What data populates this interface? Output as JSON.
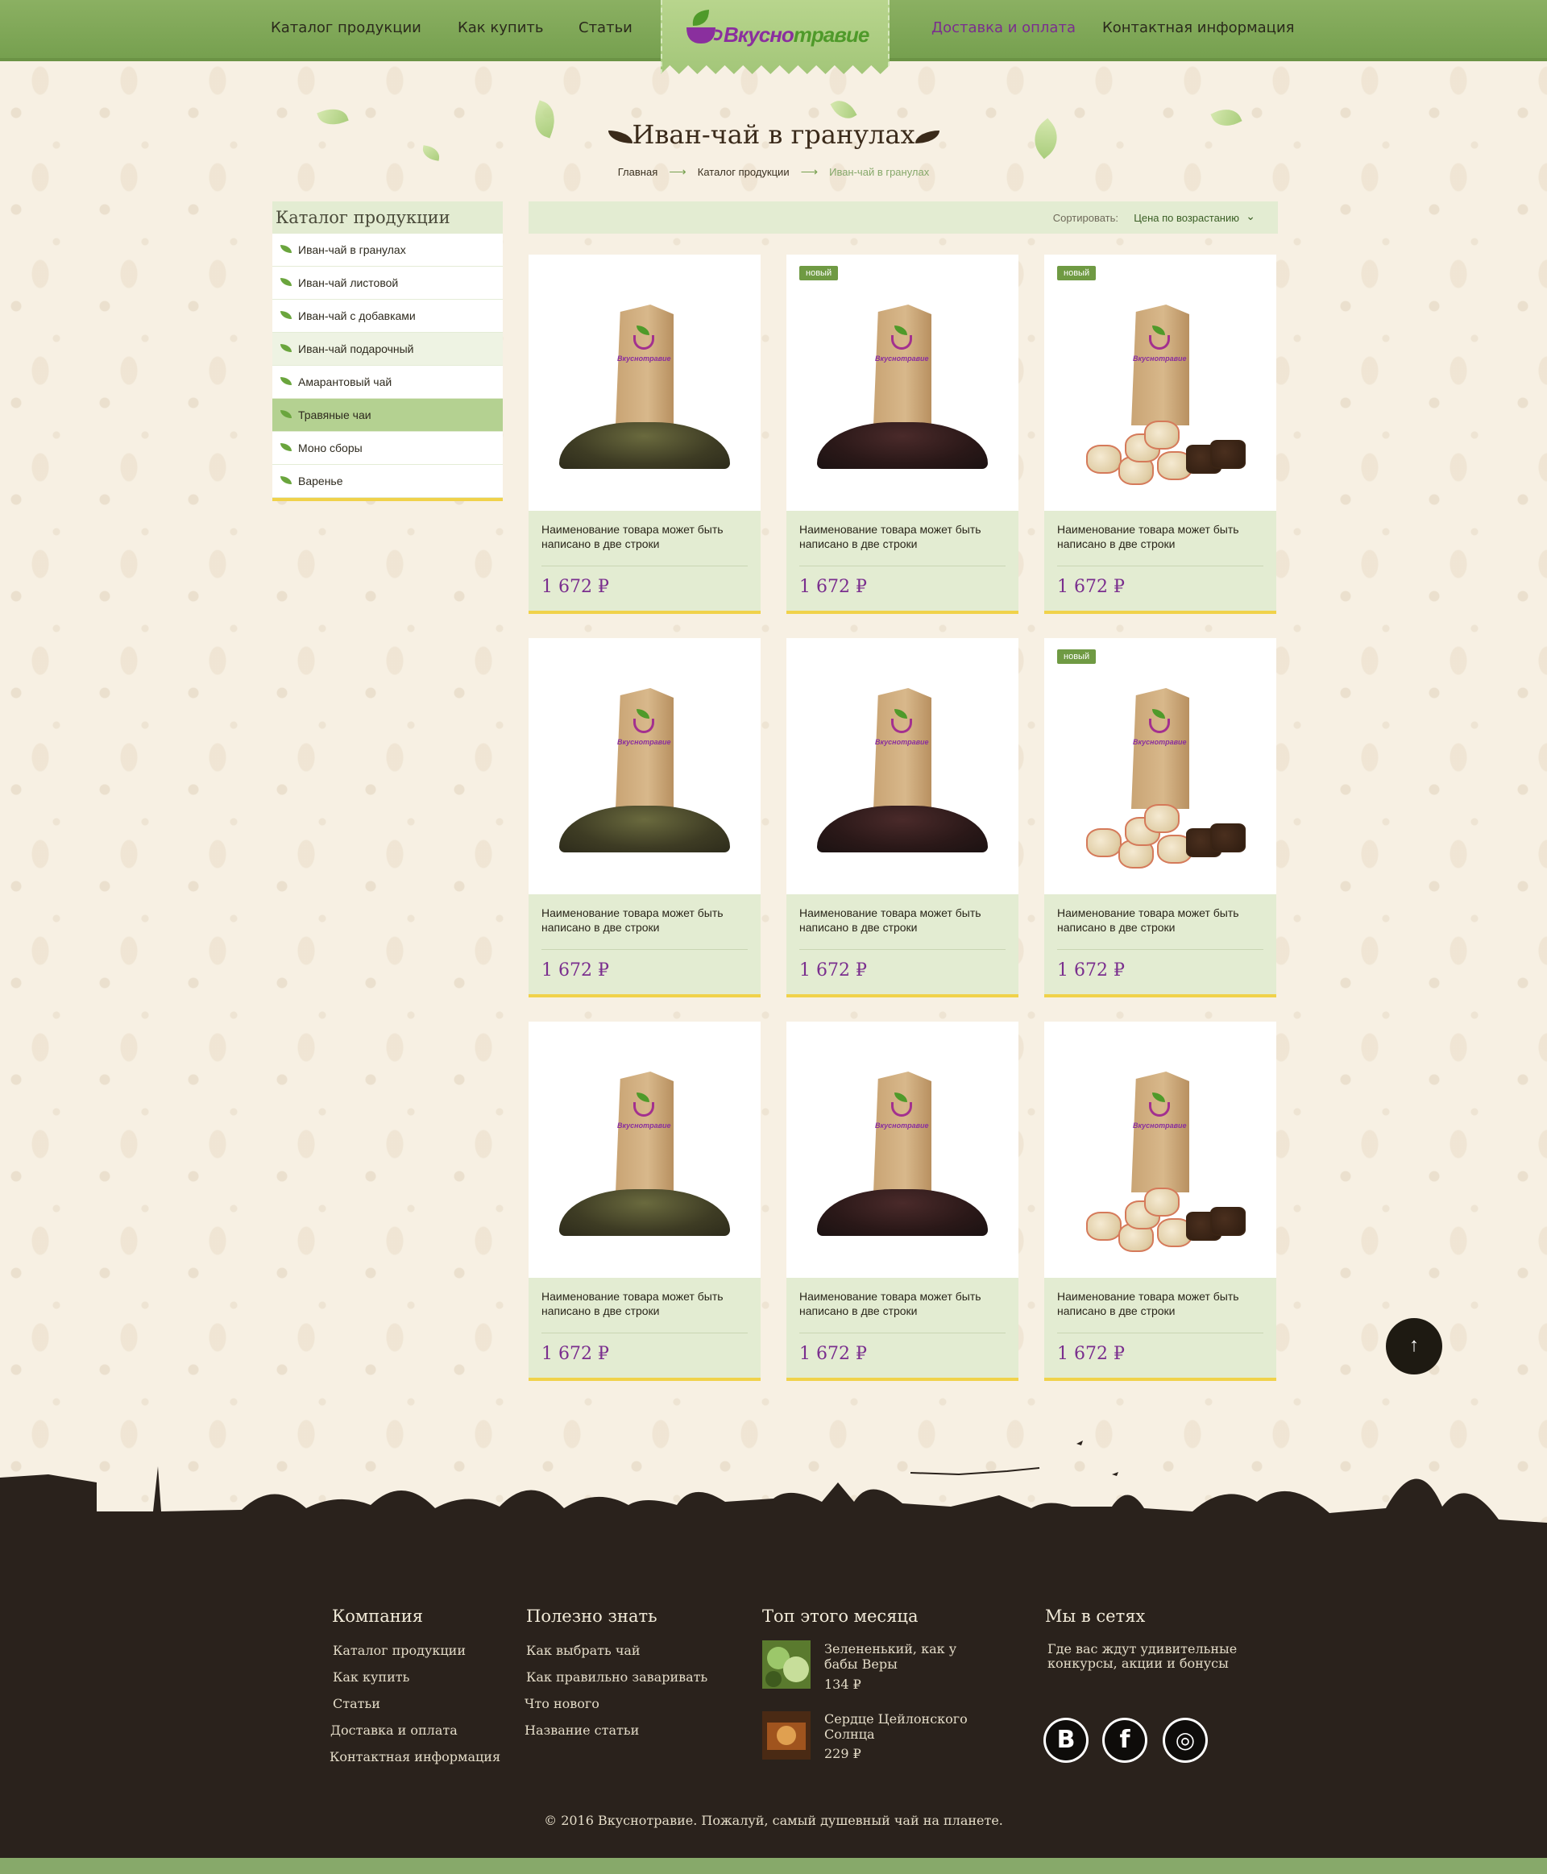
{
  "nav": {
    "items": [
      {
        "label": "Каталог продукции"
      },
      {
        "label": "Как купить"
      },
      {
        "label": "Статьи"
      },
      {
        "label": "Доставка и оплата"
      },
      {
        "label": "Контактная информация"
      }
    ],
    "logo_part1": "Вкусно",
    "logo_part2": "травие",
    "active_color": "#7a2e8e"
  },
  "page": {
    "title": "Иван-чай в гранулах",
    "breadcrumb": [
      "Главная",
      "Каталог продукции",
      "Иван-чай в гранулах"
    ],
    "breadcrumb_arrow": "⟶"
  },
  "sidebar": {
    "title": "Каталог продукции",
    "items": [
      {
        "label": "Иван-чай в гранулах"
      },
      {
        "label": "Иван-чай листовой"
      },
      {
        "label": "Иван-чай с добавками"
      },
      {
        "label": "Иван-чай подарочный"
      },
      {
        "label": "Амарантовый чай"
      },
      {
        "label": "Травяные чаи"
      },
      {
        "label": "Моно сборы"
      },
      {
        "label": "Варенье"
      }
    ],
    "selected_index": 5,
    "hover_index": 3
  },
  "sort": {
    "label": "Сортировать:",
    "value": "Цена по возрастанию",
    "icon": "chevron-down-icon"
  },
  "products": [
    {
      "name": "Наименование товара может быть написано в две строки",
      "price": "1 672 ₽",
      "badge": "",
      "kind": "green"
    },
    {
      "name": "Наименование товара может быть написано в две строки",
      "price": "1 672 ₽",
      "badge": "новый",
      "kind": "dark"
    },
    {
      "name": "Наименование товара может быть написано в две строки",
      "price": "1 672 ₽",
      "badge": "новый",
      "kind": "puerh"
    },
    {
      "name": "Наименование товара может быть написано в две строки",
      "price": "1 672 ₽",
      "badge": "",
      "kind": "green"
    },
    {
      "name": "Наименование товара может быть написано в две строки",
      "price": "1 672 ₽",
      "badge": "",
      "kind": "dark"
    },
    {
      "name": "Наименование товара может быть написано в две строки",
      "price": "1 672 ₽",
      "badge": "новый",
      "kind": "puerh"
    },
    {
      "name": "Наименование товара может быть написано в две строки",
      "price": "1 672 ₽",
      "badge": "",
      "kind": "green"
    },
    {
      "name": "Наименование товара может быть написано в две строки",
      "price": "1 672 ₽",
      "badge": "",
      "kind": "dark"
    },
    {
      "name": "Наименование товара может быть написано в две строки",
      "price": "1 672 ₽",
      "badge": "",
      "kind": "puerh"
    }
  ],
  "bag_logo": "Вкуснотравие",
  "scroll_top_label": "↑",
  "footer": {
    "company": {
      "title": "Компания",
      "links": [
        "Каталог продукции",
        "Как купить",
        "Статьи",
        "Доставка и оплата",
        "Контактная информация"
      ]
    },
    "useful": {
      "title": "Полезно знать",
      "links": [
        "Как выбрать чай",
        "Как правильно заваривать",
        "Что нового",
        "Название статьи"
      ]
    },
    "top": {
      "title": "Топ этого месяца",
      "items": [
        {
          "name": "Зелененький, как у бабы Веры",
          "price": "134 ₽"
        },
        {
          "name": "Сердце Цейлонского Солнца",
          "price": "229 ₽"
        }
      ]
    },
    "social": {
      "title": "Мы в сетях",
      "text": "Где вас ждут удивительные конкурсы, акции и бонусы",
      "networks": [
        {
          "label": "В",
          "icon": "vk-icon"
        },
        {
          "label": "f",
          "icon": "facebook-icon"
        },
        {
          "label": "◎",
          "icon": "instagram-icon"
        }
      ]
    },
    "copyright": "© 2016 Вкуснотравие. Пожалуй, самый душевный чай на планете."
  }
}
